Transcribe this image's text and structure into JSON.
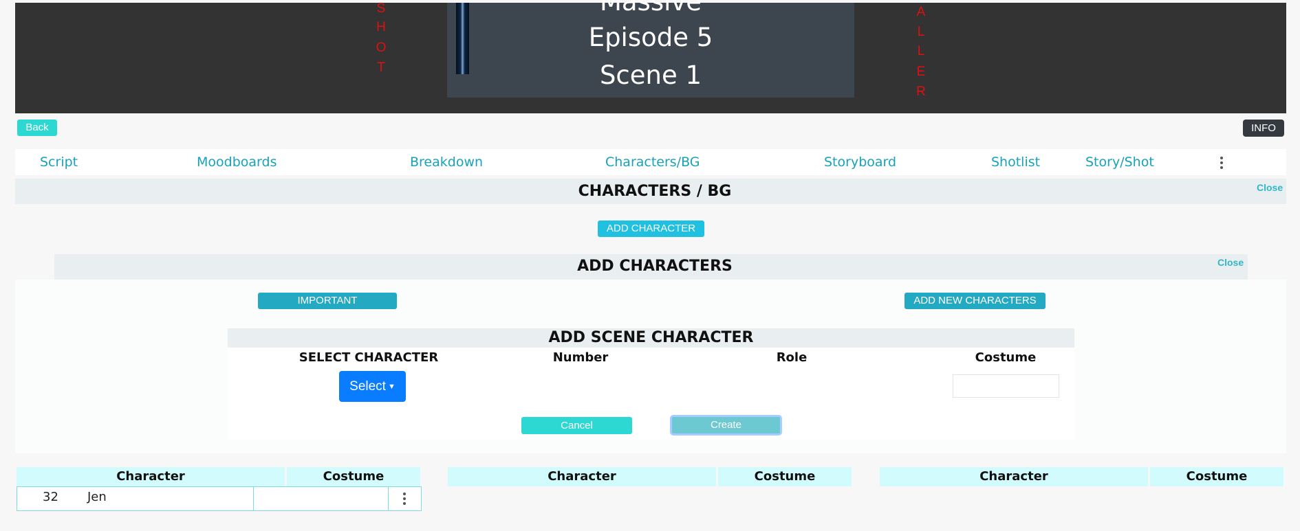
{
  "header": {
    "title_lines": [
      "Massive",
      "Episode 5",
      "Scene 1"
    ],
    "left_vertical": [
      "S",
      "H",
      "O",
      "T"
    ],
    "right_vertical": [
      "A",
      "L",
      "L",
      "E",
      "R"
    ]
  },
  "buttons": {
    "back": "Back",
    "info": "INFO"
  },
  "nav": {
    "tabs": [
      "Script",
      "Moodboards",
      "Breakdown",
      "Characters/BG",
      "Storyboard",
      "Shotlist",
      "Story/Shot"
    ]
  },
  "characters_bg": {
    "title": "CHARACTERS / BG",
    "close": "Close",
    "add_button": "ADD CHARACTER"
  },
  "add_characters": {
    "title": "ADD CHARACTERS",
    "close": "Close",
    "important_button": "IMPORTANT",
    "add_new_button": "ADD NEW CHARACTERS"
  },
  "scene_character": {
    "title": "ADD SCENE CHARACTER",
    "columns": [
      "SELECT CHARACTER",
      "Number",
      "Role",
      "Costume"
    ],
    "select_label": "Select",
    "costume_value": "",
    "cancel": "Cancel",
    "create": "Create"
  },
  "tables": [
    {
      "headers": [
        "Character",
        "Costume"
      ],
      "rows": [
        {
          "number": "32",
          "name": "Jen",
          "costume": ""
        }
      ]
    },
    {
      "headers": [
        "Character",
        "Costume"
      ],
      "rows": []
    },
    {
      "headers": [
        "Character",
        "Costume"
      ],
      "rows": []
    }
  ],
  "colors": {
    "accent": "#17a2b8",
    "primary": "#0a7cff",
    "red_text": "#e01010",
    "header_bg": "#333333"
  }
}
